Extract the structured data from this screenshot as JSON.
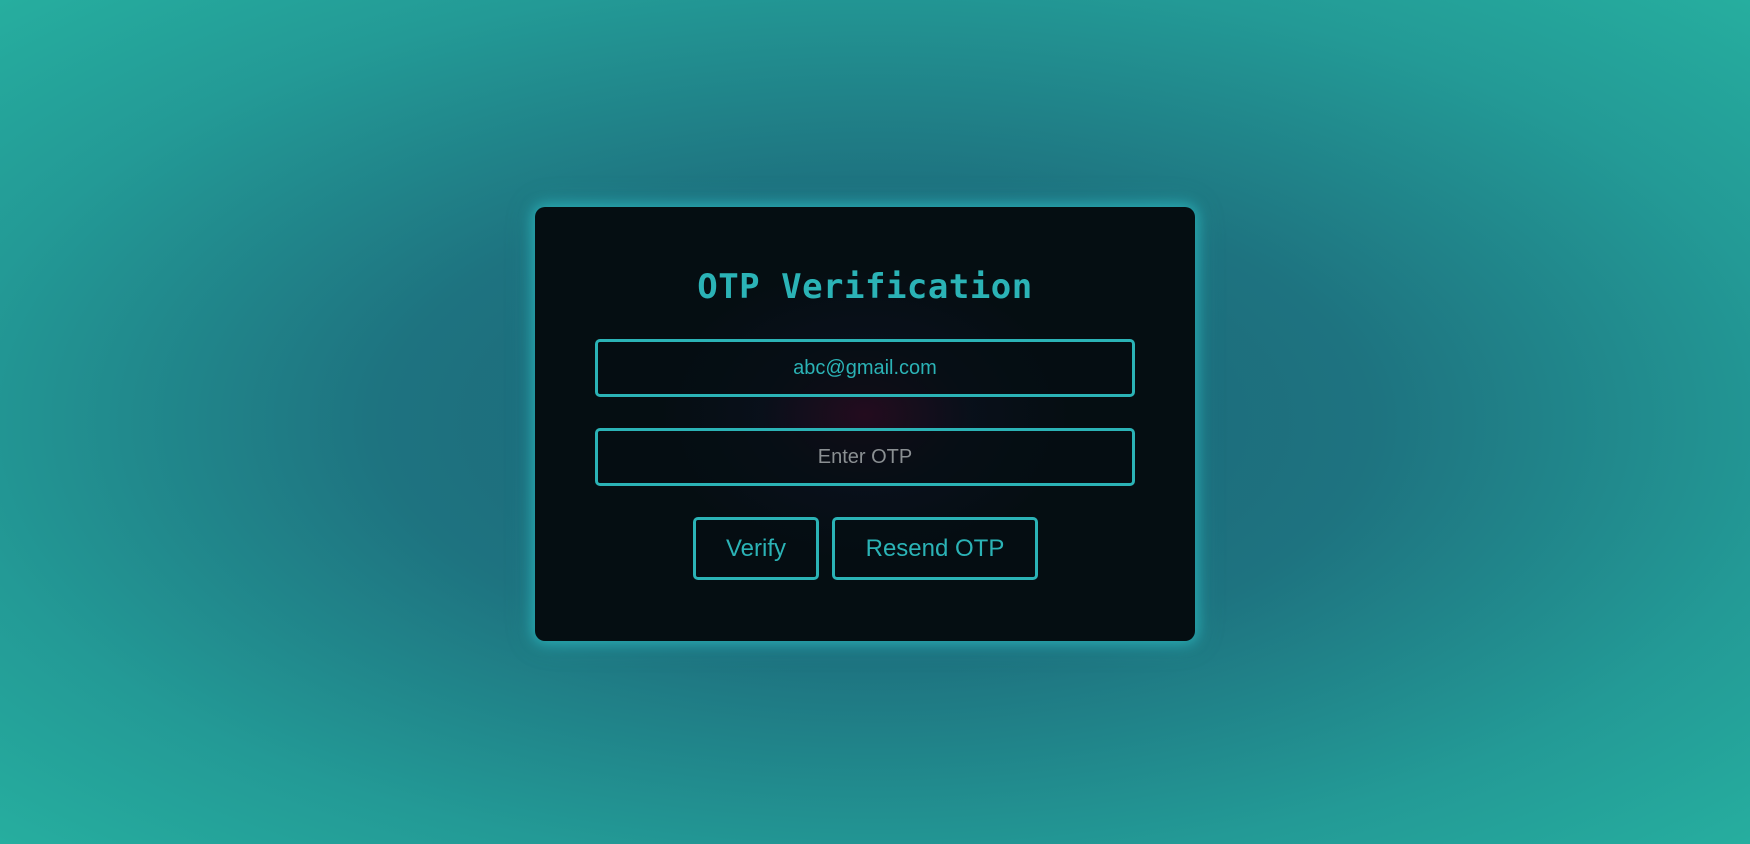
{
  "card": {
    "title": "OTP Verification",
    "email_value": "abc@gmail.com",
    "otp_placeholder": "Enter OTP",
    "verify_label": "Verify",
    "resend_label": "Resend OTP"
  },
  "colors": {
    "accent": "#2bb3b6",
    "card_bg": "#050e12",
    "bg_center": "#1b6477",
    "bg_edge": "#26ae9f"
  }
}
